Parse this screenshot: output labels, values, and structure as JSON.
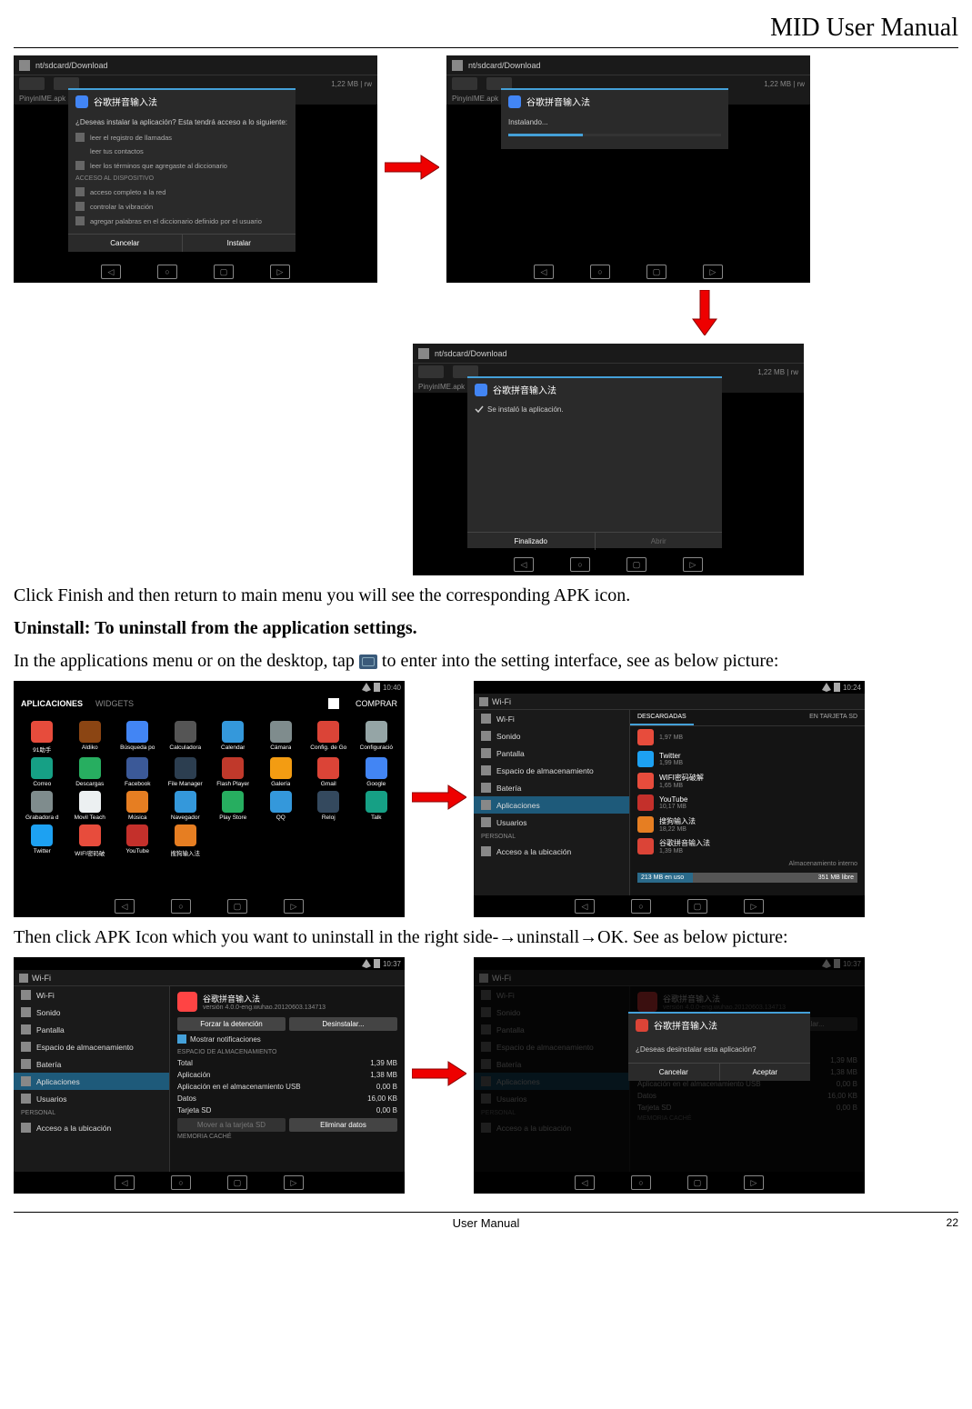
{
  "header": {
    "title": "MID User Manual"
  },
  "footer": {
    "center": "User Manual",
    "page": "22"
  },
  "text": {
    "line1": "Click Finish and then return to main menu you will see the corresponding APK icon.",
    "line2": "Uninstall: To uninstall from the application settings.",
    "line3a": "In the applications menu or on the desktop, tap ",
    "line3b": " to enter into the setting interface, see as below picture:",
    "line4": "Then click APK Icon which you want to uninstall in the right side-→uninstall→OK. See as below picture:"
  },
  "install": {
    "path": "nt/sdcard/Download",
    "apk": "PinyinIME.apk",
    "size": "1,22 MB | rw",
    "app_name": "谷歌拼音输入法",
    "question": "¿Deseas instalar la aplicación? Esta tendrá acceso a lo siguiente:",
    "perm_section1": "",
    "perms1": [
      "leer el registro de llamadas",
      "leer tus contactos",
      "leer los términos que agregaste al diccionario"
    ],
    "perm_section2": "ACCESO AL DISPOSITIVO",
    "perms2": [
      "acceso completo a la red",
      "controlar la vibración",
      "agregar palabras en el diccionario definido por el usuario"
    ],
    "btn_cancel": "Cancelar",
    "btn_install": "Instalar",
    "installing": "Instalando...",
    "installed": "Se instaló la aplicación.",
    "btn_done": "Finalizado",
    "btn_open": "Abrir"
  },
  "apps_screen": {
    "tab_apps": "APLICACIONES",
    "tab_widgets": "WIDGETS",
    "buy": "COMPRAR",
    "time": "10:40",
    "items": [
      {
        "label": "91助手",
        "color": "#e74c3c"
      },
      {
        "label": "Aldiko",
        "color": "#8b4513"
      },
      {
        "label": "Búsqueda po",
        "color": "#4285f4"
      },
      {
        "label": "Calculadora",
        "color": "#555"
      },
      {
        "label": "Calendar",
        "color": "#3498db"
      },
      {
        "label": "Cámara",
        "color": "#7f8c8d"
      },
      {
        "label": "Config. de Go",
        "color": "#db4437"
      },
      {
        "label": "Configuració",
        "color": "#95a5a6"
      },
      {
        "label": "Correo",
        "color": "#16a085"
      },
      {
        "label": "Descargas",
        "color": "#27ae60"
      },
      {
        "label": "Facebook",
        "color": "#3b5998"
      },
      {
        "label": "File Manager",
        "color": "#2c3e50"
      },
      {
        "label": "Flash Player",
        "color": "#c0392b"
      },
      {
        "label": "Galería",
        "color": "#f39c12"
      },
      {
        "label": "Gmail",
        "color": "#db4437"
      },
      {
        "label": "Google",
        "color": "#4285f4"
      },
      {
        "label": "Grabadora d",
        "color": "#7f8c8d"
      },
      {
        "label": "Movil Teach",
        "color": "#ecf0f1"
      },
      {
        "label": "Música",
        "color": "#e67e22"
      },
      {
        "label": "Navegador",
        "color": "#3498db"
      },
      {
        "label": "Play Store",
        "color": "#27ae60"
      },
      {
        "label": "QQ",
        "color": "#3498db"
      },
      {
        "label": "Reloj",
        "color": "#34495e"
      },
      {
        "label": "Talk",
        "color": "#16a085"
      },
      {
        "label": "Twitter",
        "color": "#1da1f2"
      },
      {
        "label": "WIFI密码破",
        "color": "#e74c3c"
      },
      {
        "label": "YouTube",
        "color": "#c4302b"
      },
      {
        "label": "搜狗输入法",
        "color": "#e67e22"
      }
    ]
  },
  "settings": {
    "title": "Wi-Fi",
    "time": "10:24",
    "left_items": [
      {
        "label": "Wi-Fi",
        "active": false,
        "section": false,
        "icon": true,
        "hidden": true
      },
      {
        "label": "Sonido",
        "active": false,
        "section": false,
        "icon": true
      },
      {
        "label": "Pantalla",
        "active": false,
        "section": false,
        "icon": true
      },
      {
        "label": "Espacio de almacenamiento",
        "active": false,
        "section": false,
        "icon": true
      },
      {
        "label": "Batería",
        "active": false,
        "section": false,
        "icon": true
      },
      {
        "label": "Aplicaciones",
        "active": true,
        "section": false,
        "icon": true
      },
      {
        "label": "Usuarios",
        "active": false,
        "section": false,
        "icon": true
      },
      {
        "label": "PERSONAL",
        "active": false,
        "section": true,
        "icon": false
      },
      {
        "label": "Acceso a la ubicación",
        "active": false,
        "section": false,
        "icon": true
      }
    ],
    "tab_downloaded": "DESCARGADAS",
    "tab_sd": "EN TARJETA SD",
    "applist": [
      {
        "name": "",
        "size": "1,97 MB",
        "color": "#e74c3c"
      },
      {
        "name": "Twitter",
        "size": "1,99 MB",
        "color": "#1da1f2"
      },
      {
        "name": "WIFI密码破解",
        "size": "1,65 MB",
        "color": "#e74c3c"
      },
      {
        "name": "YouTube",
        "size": "10,17 MB",
        "color": "#c4302b"
      },
      {
        "name": "搜狗输入法",
        "size": "18,22 MB",
        "color": "#e67e22"
      },
      {
        "name": "谷歌拼音输入法",
        "size": "1,39 MB",
        "color": "#db4437"
      }
    ],
    "storage_title": "Almacenamiento interno",
    "storage_used": "213 MB en uso",
    "storage_free": "351 MB libre"
  },
  "app_detail": {
    "time": "10:37",
    "title": "Wi-Fi",
    "app_name": "谷歌拼音输入法",
    "version": "versión 4.0.0-eng.wuhao.20120603.134713",
    "btn_force": "Forzar la detención",
    "btn_uninstall": "Desinstalar...",
    "notif": "Mostrar notificaciones",
    "section_storage": "ESPACIO DE ALMACENAMIENTO",
    "lines": [
      {
        "k": "Total",
        "v": "1,39 MB"
      },
      {
        "k": "Aplicación",
        "v": "1,38 MB"
      },
      {
        "k": "Aplicación en el almacenamiento USB",
        "v": "0,00 B"
      },
      {
        "k": "Datos",
        "v": "16,00 KB"
      },
      {
        "k": "Tarjeta SD",
        "v": "0,00 B"
      }
    ],
    "btn_move": "Mover a la tarjeta SD",
    "btn_clear": "Eliminar datos",
    "section_cache": "MEMORIA CACHÉ"
  },
  "confirm": {
    "title": "谷歌拼音输入法",
    "question": "¿Deseas desinstalar esta aplicación?",
    "btn_cancel": "Cancelar",
    "btn_ok": "Aceptar"
  }
}
